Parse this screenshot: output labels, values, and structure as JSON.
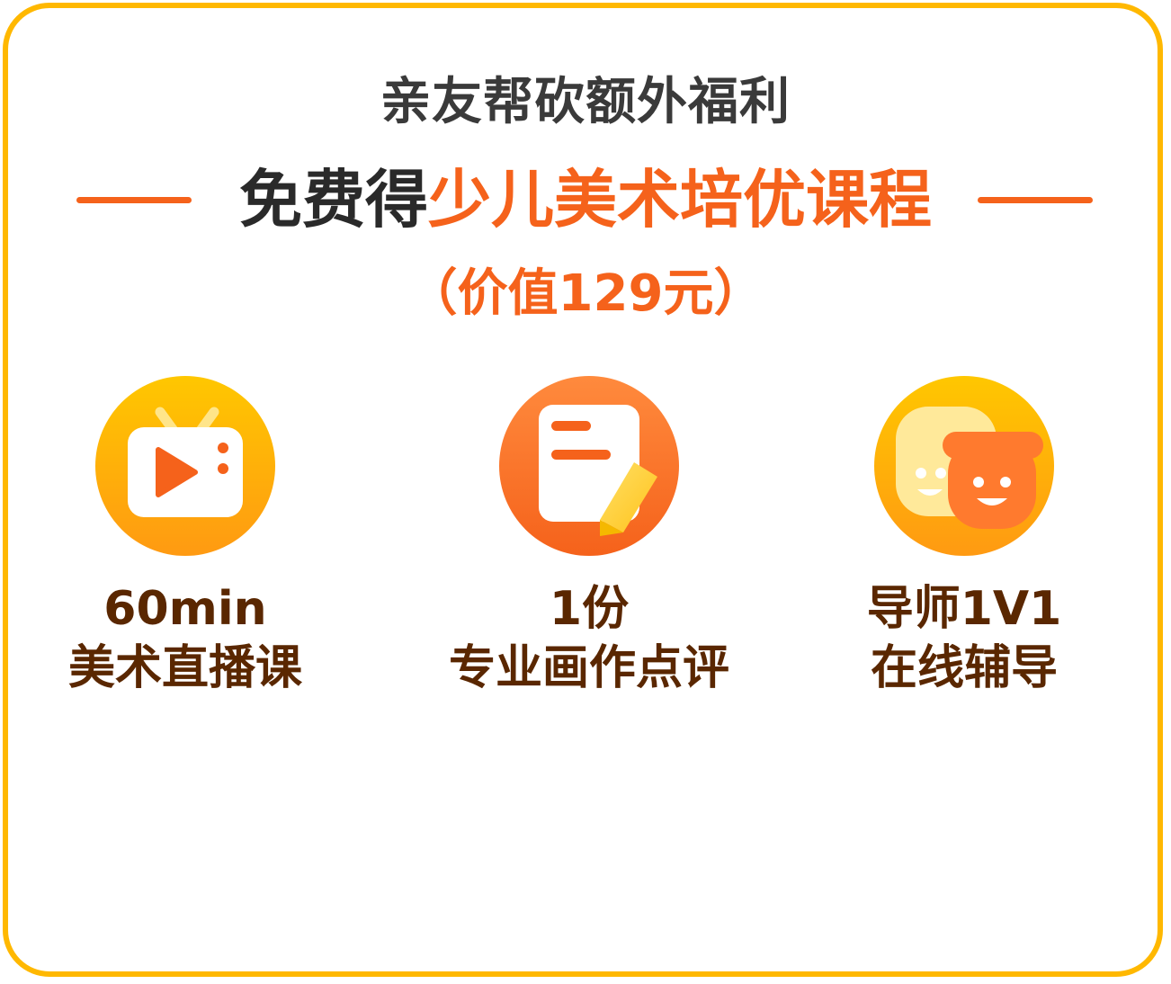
{
  "header": {
    "subtitle": "亲友帮砍额外福利",
    "headline_dark": "免费得",
    "headline_accent": "少儿美术培优课程",
    "value": "（价值129元）"
  },
  "colors": {
    "border": "#FFB800",
    "accent": "#F5621B",
    "text_dark": "#2a2a2a",
    "feature_text": "#5A2700"
  },
  "features": [
    {
      "icon": "tv-play-icon",
      "line1": "60min",
      "line2": "美术直播课"
    },
    {
      "icon": "document-pencil-icon",
      "line1": "1份",
      "line2": "专业画作点评"
    },
    {
      "icon": "tutor-child-faces-icon",
      "line1": "导师1V1",
      "line2": "在线辅导"
    }
  ]
}
